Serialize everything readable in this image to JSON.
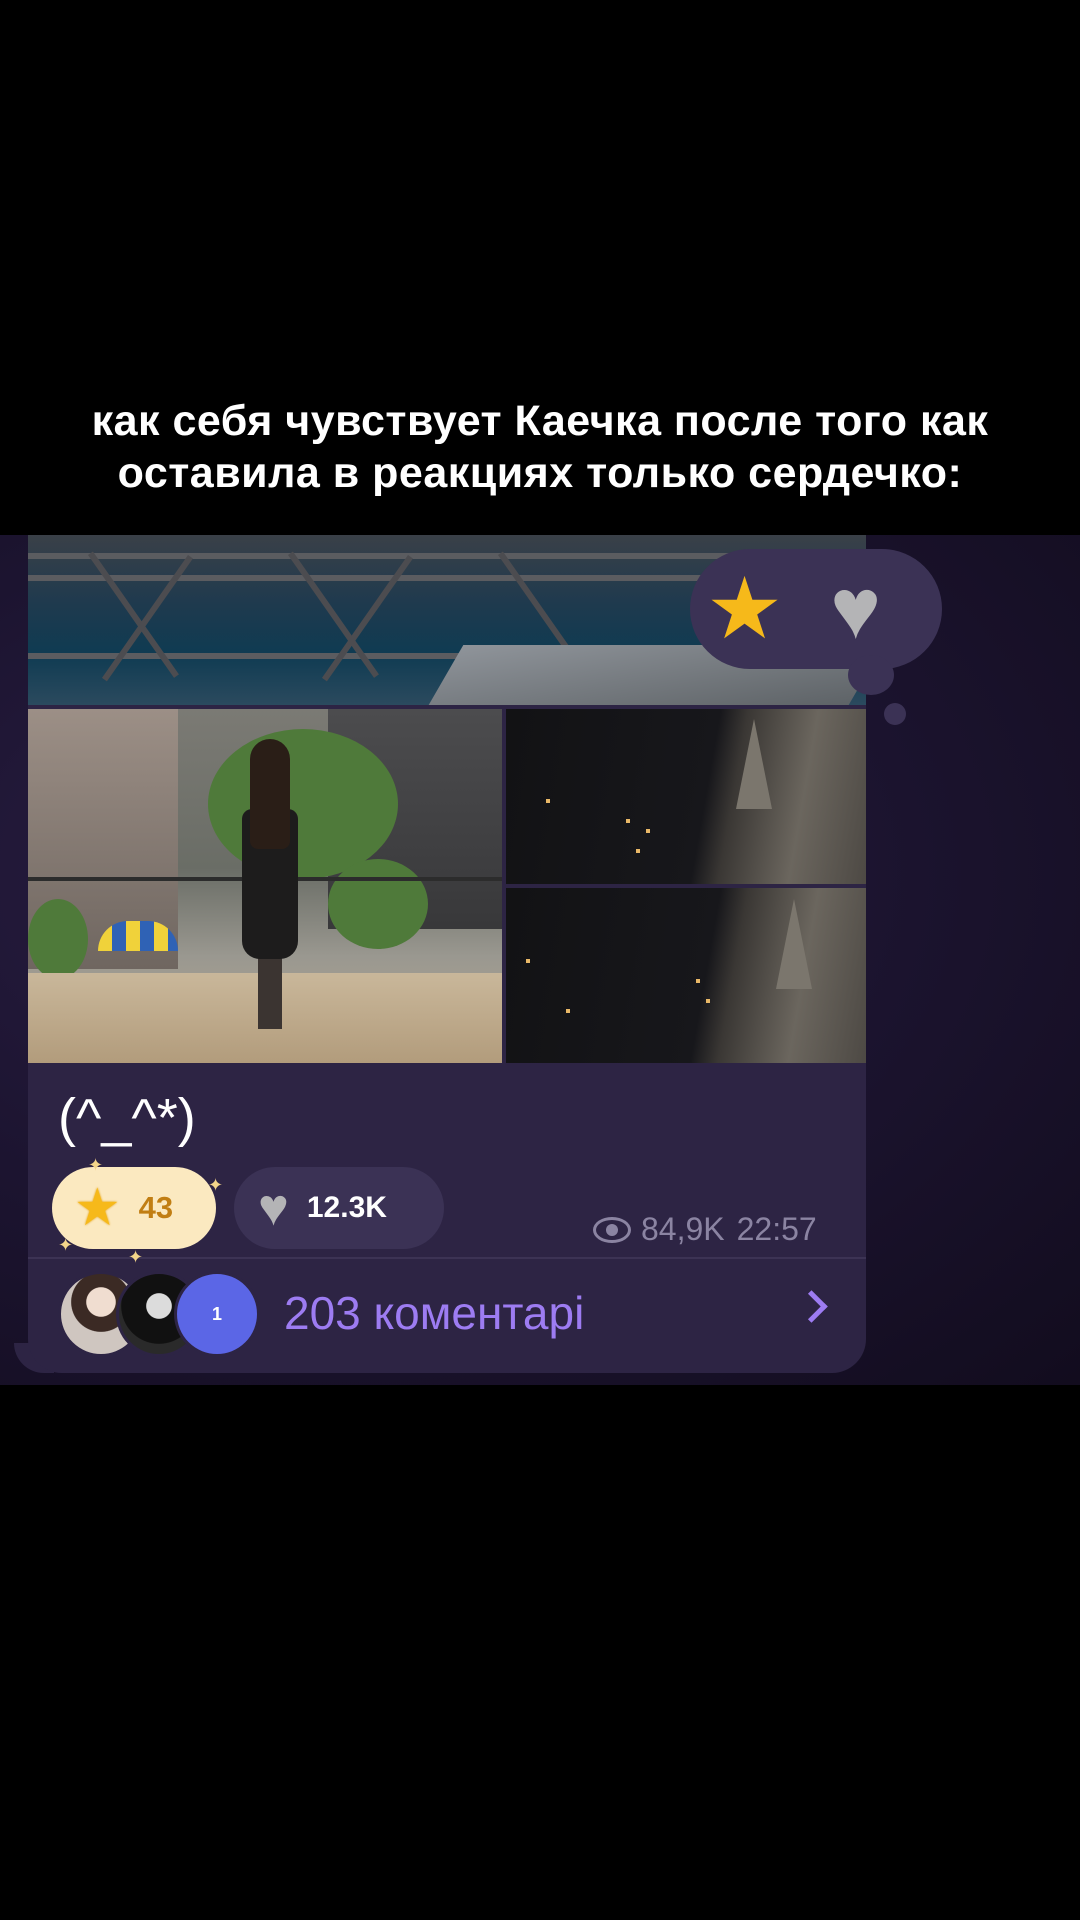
{
  "caption": {
    "line1": "как себя чувствует Каечка после того как",
    "line2": "оставила в реакциях только сердечко:"
  },
  "post": {
    "text": "(^_^*)",
    "reactions": [
      {
        "icon": "star-icon",
        "count": "43",
        "selected": true
      },
      {
        "icon": "gray-heart-icon",
        "count": "12.3K",
        "selected": false
      }
    ],
    "views": "84,9K",
    "time": "22:57",
    "comments": {
      "avatar_badge": "1",
      "label": "203 коментарі"
    }
  },
  "reaction_picker": {
    "options": [
      "star-icon",
      "gray-heart-icon"
    ]
  },
  "colors": {
    "bubble": "#2d2444",
    "accent": "#9d7cf2",
    "star_chip": "#fbe9c0",
    "star_count": "#c17e13"
  }
}
